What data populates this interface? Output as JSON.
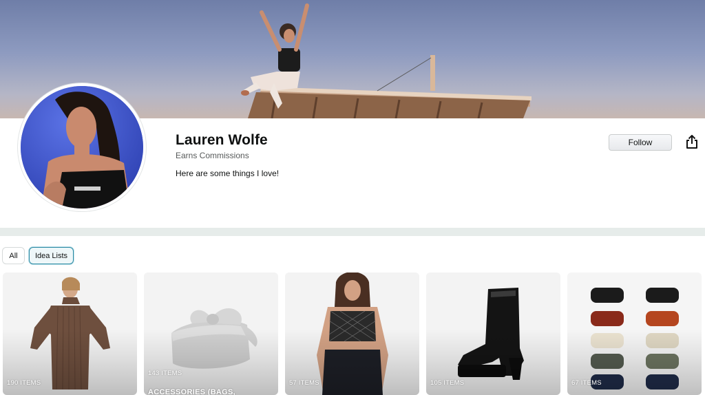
{
  "profile": {
    "name": "Lauren Wolfe",
    "earns": "Earns Commissions",
    "bio": "Here are some things I love!",
    "follow_label": "Follow"
  },
  "icons": {
    "share": "share-icon"
  },
  "filters": {
    "all": "All",
    "idea_lists": "Idea Lists",
    "selected": "Idea Lists"
  },
  "colors": {
    "accent": "#2b8aa3",
    "divider": "#e6ecea"
  },
  "cards": [
    {
      "count": "190 ITEMS",
      "title": ""
    },
    {
      "count": "143 ITEMS",
      "title": "ACCESSORIES (BAGS,"
    },
    {
      "count": "57 ITEMS",
      "title": ""
    },
    {
      "count": "105 ITEMS",
      "title": ""
    },
    {
      "count": "67 ITEMS",
      "title": ""
    }
  ]
}
